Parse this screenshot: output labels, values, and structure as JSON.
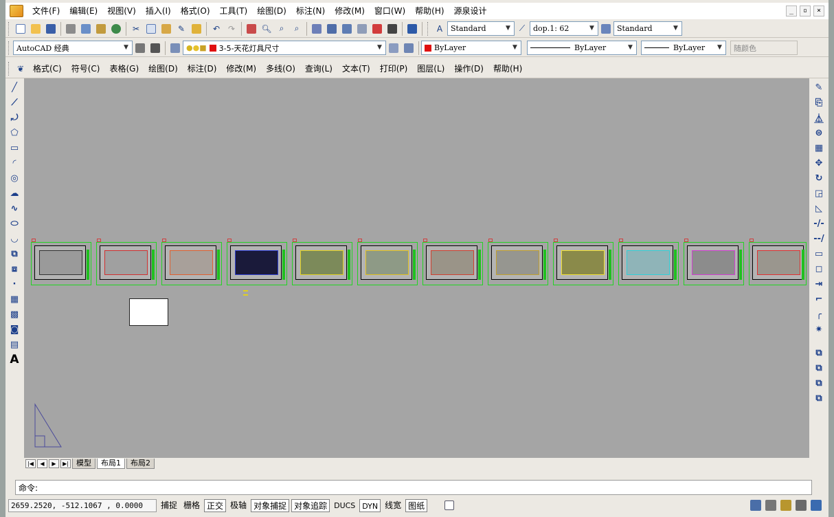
{
  "menubar": {
    "items": [
      "文件(F)",
      "编辑(E)",
      "视图(V)",
      "插入(I)",
      "格式(O)",
      "工具(T)",
      "绘图(D)",
      "标注(N)",
      "修改(M)",
      "窗口(W)",
      "帮助(H)",
      "源泉设计"
    ],
    "window_controls": [
      "_",
      "▫",
      "×"
    ]
  },
  "toolbar1": {
    "text_style": "Standard",
    "dim_style": "dop.1: 62",
    "table_style": "Standard"
  },
  "toolbar2": {
    "workspace": "AutoCAD 经典",
    "layer": "3-5-天花灯具尺寸",
    "layer_color": "#e01010",
    "color": "ByLayer",
    "color_swatch": "#e01010",
    "linetype": "ByLayer",
    "lineweight": "ByLayer",
    "plotstyle": "随颜色"
  },
  "toolbar3": {
    "items": [
      "格式(C)",
      "符号(C)",
      "表格(G)",
      "绘图(D)",
      "标注(D)",
      "修改(M)",
      "多线(O)",
      "查询(L)",
      "文本(T)",
      "打印(P)",
      "图层(L)",
      "操作(D)",
      "帮助(H)"
    ]
  },
  "layout_tabs": {
    "tabs": [
      "模型",
      "布局1",
      "布局2"
    ],
    "active": "布局1"
  },
  "command": {
    "prompt": "命令:"
  },
  "statusbar": {
    "coords": "2659.2520,  -512.1067 ,  0.0000",
    "toggles": [
      {
        "label": "捕捉",
        "on": false
      },
      {
        "label": "栅格",
        "on": false
      },
      {
        "label": "正交",
        "on": true
      },
      {
        "label": "极轴",
        "on": false
      },
      {
        "label": "对象捕捉",
        "on": true
      },
      {
        "label": "对象追踪",
        "on": true
      },
      {
        "label": "DUCS",
        "on": false
      },
      {
        "label": "DYN",
        "on": true
      },
      {
        "label": "线宽",
        "on": false
      },
      {
        "label": "图纸",
        "on": true
      }
    ]
  },
  "colors": {
    "canvas": "#a5a5a5",
    "frame": "#22d422"
  }
}
